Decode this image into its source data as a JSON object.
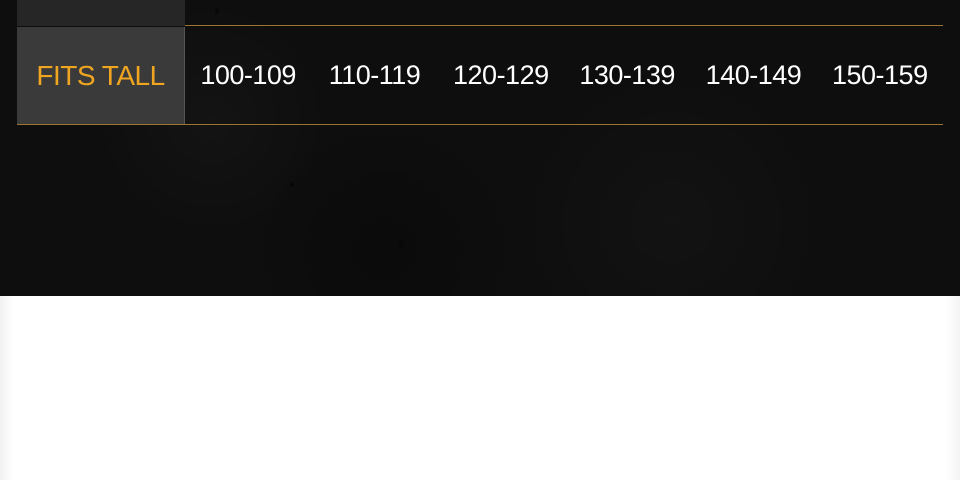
{
  "size_table": {
    "row_label": "FITS TALL",
    "ranges": [
      "100-109",
      "110-119",
      "120-129",
      "130-139",
      "140-149",
      "150-159"
    ]
  },
  "colors": {
    "background": "#0e0e0e",
    "label_cell": "#3a3a3a",
    "label_text": "#f0a521",
    "value_text": "#ffffff",
    "rule": "#9a7430"
  }
}
